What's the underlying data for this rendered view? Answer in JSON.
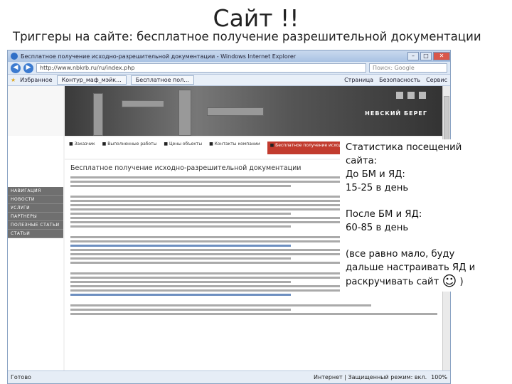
{
  "slide": {
    "title": "Сайт !!",
    "subtitle": "Триггеры на сайте: бесплатное получение разрешительной документации"
  },
  "browser": {
    "window_title": "Бесплатное получение исходно-разрешительной документации - Windows Internet Explorer",
    "url": "http://www.nbkrb.ru/ru/index.php",
    "search_placeholder": "Поиск: Google",
    "favorites_label": "Избранное",
    "tabs": [
      "Контур_маф_мэйк...",
      "Бесплатное пол..."
    ],
    "tools": [
      "Страница",
      "Безопасность",
      "Сервис"
    ],
    "status_left": "Готово",
    "status_zone": "Интернет | Защищенный режим: вкл.",
    "zoom": "100%"
  },
  "website": {
    "sidebar_menu": [
      "НАВИГАЦИЯ",
      "НОВОСТИ",
      "УСЛУГИ",
      "ПАРТНЕРЫ",
      "ПОЛЕЗНЫЕ СТАТЬИ",
      "СТАТЬИ"
    ],
    "brand": "НЕВСКИЙ БЕРЕГ",
    "nav": [
      "Заказчик",
      "Выполненные работы",
      "Цены объекты",
      "Контакты компании"
    ],
    "nav_active": "Бесплатное получение исходно-разрешительной документации",
    "page_heading": "Бесплатное получение исходно-разрешительной документации"
  },
  "overlay": {
    "stats_before": "Статистика посещений сайта:\nДо БМ и ЯД:\n15-25 в день",
    "stats_after": "После БМ и ЯД:\n60-85 в день",
    "note": "(все равно мало, буду дальше настраивать ЯД и раскручивать сайт",
    "smiley": "☺",
    "closing": " )"
  }
}
